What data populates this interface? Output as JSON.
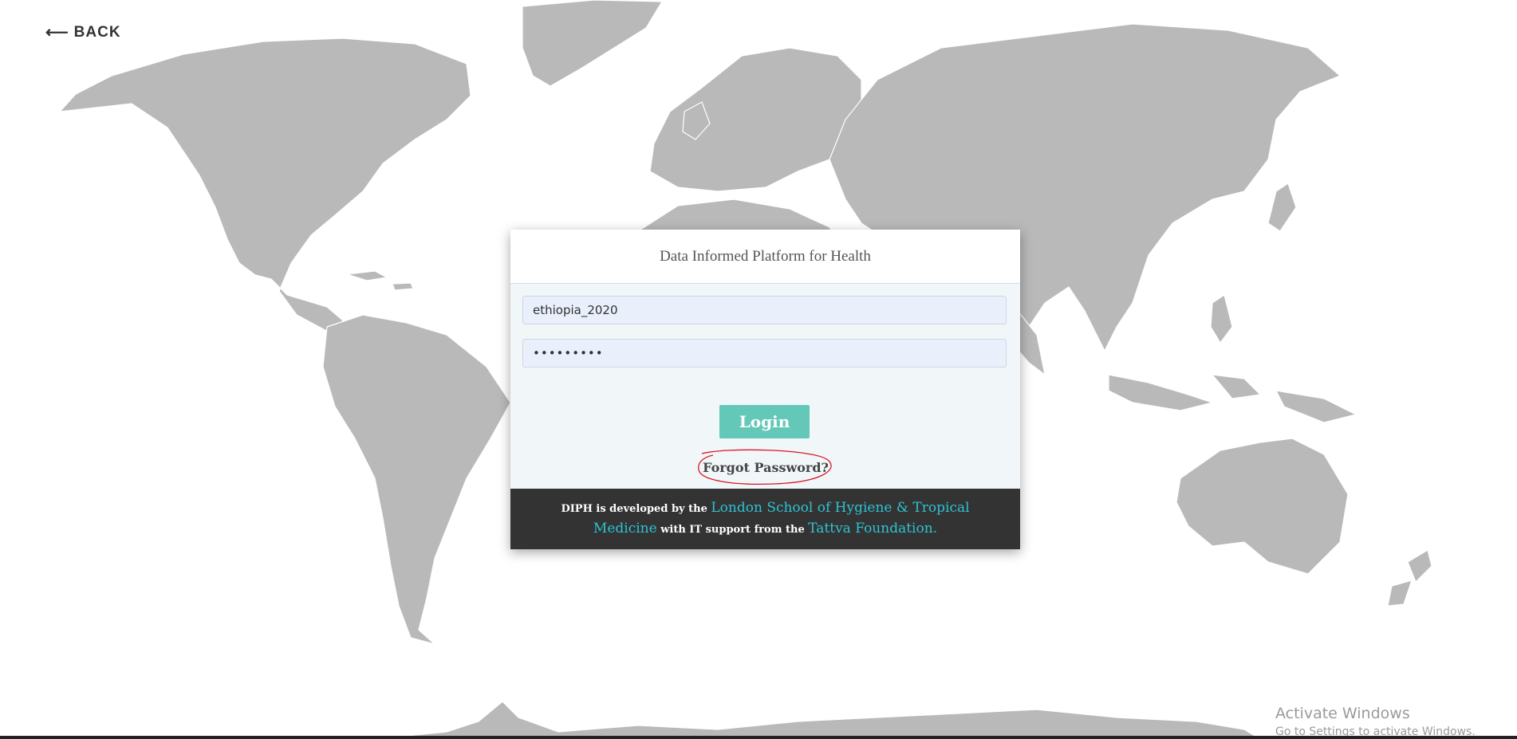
{
  "nav": {
    "back_arrow": "⟵",
    "back_label": "BACK"
  },
  "login": {
    "title": "Data Informed Platform for Health",
    "username_value": "ethiopia_2020",
    "password_value": "•••••••••",
    "login_label": "Login",
    "forgot_label": "Forgot Password?"
  },
  "footer": {
    "text_1": "DIPH is developed by the ",
    "link_1": "London School of Hygiene & Tropical Medicine",
    "text_2": " with IT support from the ",
    "link_2": "Tattva Foundation."
  },
  "windows_notice": {
    "title": "Activate Windows",
    "subtitle": "Go to Settings to activate Windows."
  },
  "colors": {
    "land": "#b9b9b9",
    "login_button": "#64c8b8",
    "footer_bg": "#333333",
    "footer_link": "#2ec3d3",
    "annotation_circle": "#d9182b"
  }
}
